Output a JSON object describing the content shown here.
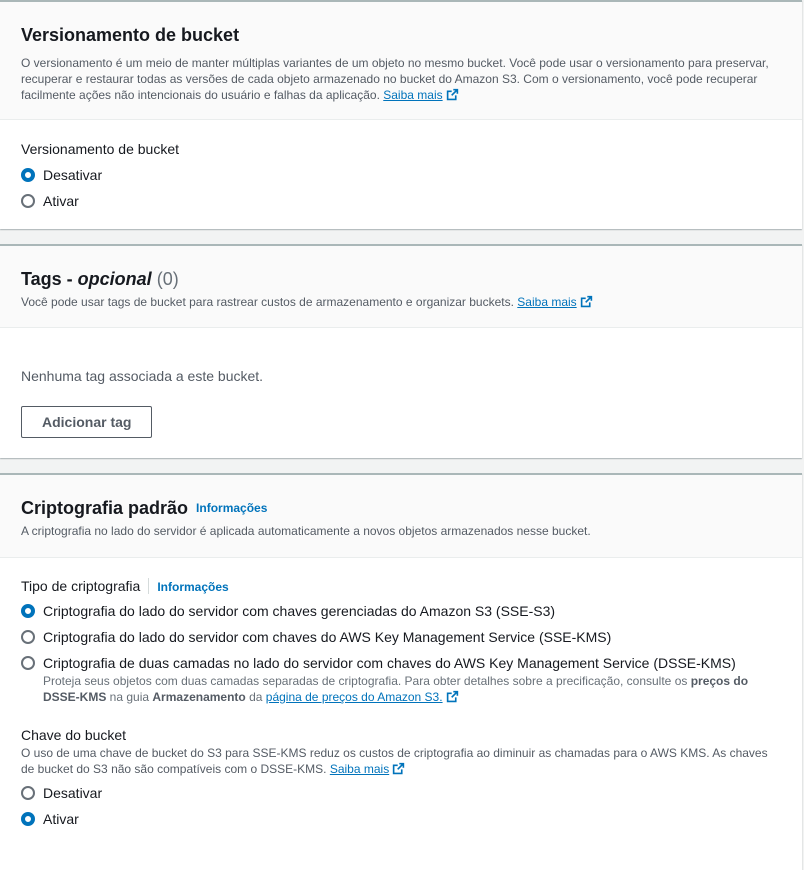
{
  "versioning": {
    "title": "Versionamento de bucket",
    "description": "O versionamento é um meio de manter múltiplas variantes de um objeto no mesmo bucket. Você pode usar o versionamento para preservar, recuperar e restaurar todas as versões de cada objeto armazenado no bucket do Amazon S3. Com o versionamento, você pode recuperar facilmente ações não intencionais do usuário e falhas da aplicação.",
    "learn_more": "Saiba mais",
    "field_label": "Versionamento de bucket",
    "options": [
      {
        "label": "Desativar",
        "checked": true
      },
      {
        "label": "Ativar",
        "checked": false
      }
    ]
  },
  "tags": {
    "title": "Tags - ",
    "title_optional": "opcional",
    "count": "(0)",
    "description": "Você pode usar tags de bucket para rastrear custos de armazenamento e organizar buckets.",
    "learn_more": "Saiba mais",
    "empty_text": "Nenhuma tag associada a este bucket.",
    "add_button": "Adicionar tag"
  },
  "encryption": {
    "title": "Criptografia padrão",
    "info": "Informações",
    "description": "A criptografia no lado do servidor é aplicada automaticamente a novos objetos armazenados nesse bucket.",
    "type_label": "Tipo de criptografia",
    "type_info": "Informações",
    "options": [
      {
        "label": "Criptografia do lado do servidor com chaves gerenciadas do Amazon S3 (SSE-S3)",
        "checked": true
      },
      {
        "label": "Criptografia do lado do servidor com chaves do AWS Key Management Service (SSE-KMS)",
        "checked": false
      },
      {
        "label": "Criptografia de duas camadas no lado do servidor com chaves do AWS Key Management Service (DSSE-KMS)",
        "checked": false
      }
    ],
    "dsse_sub_1": "Proteja seus objetos com duas camadas separadas de criptografia. Para obter detalhes sobre a precificação, consulte os ",
    "dsse_sub_bold1": "preços do DSSE-KMS",
    "dsse_sub_2": " na guia ",
    "dsse_sub_bold2": "Armazenamento",
    "dsse_sub_3": " da ",
    "dsse_sub_link": "página de preços do Amazon S3.",
    "bucket_key_label": "Chave do bucket",
    "bucket_key_desc": "O uso de uma chave de bucket do S3 para SSE-KMS reduz os custos de criptografia ao diminuir as chamadas para o AWS KMS. As chaves de bucket do S3 não são compatíveis com o DSSE-KMS.",
    "bucket_key_learn_more": "Saiba mais",
    "bucket_key_options": [
      {
        "label": "Desativar",
        "checked": false
      },
      {
        "label": "Ativar",
        "checked": true
      }
    ]
  },
  "colors": {
    "accent": "#0073bb",
    "text": "#16191f",
    "muted": "#545b64"
  }
}
